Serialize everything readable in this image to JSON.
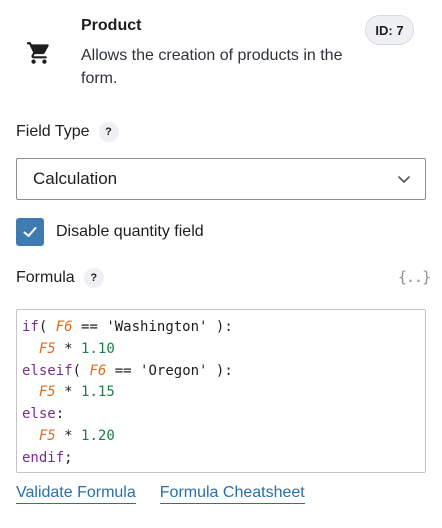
{
  "product": {
    "icon": "shopping-cart-icon",
    "title": "Product",
    "description": "Allows the creation of products in the form.",
    "id_badge": "ID: 7"
  },
  "field_type": {
    "label": "Field Type",
    "help": "?",
    "selected": "Calculation"
  },
  "disable_quantity": {
    "label": "Disable quantity field",
    "checked": true
  },
  "formula": {
    "label": "Formula",
    "help": "?",
    "vars_icon": "{..}",
    "lines": [
      "if( F6 == 'Washington' ):",
      "  F5 * 1.10",
      "elseif( F6 == 'Oregon' ):",
      "  F5 * 1.15",
      "else:",
      "  F5 * 1.20",
      "endif;"
    ]
  },
  "links": {
    "validate": "Validate Formula",
    "cheatsheet": "Formula Cheatsheet"
  },
  "colors": {
    "accent": "#3e7bb0",
    "link": "#2a6fa8",
    "keyword": "#7a2f8f",
    "variable": "#e06c1c",
    "number": "#1a7f4b"
  }
}
